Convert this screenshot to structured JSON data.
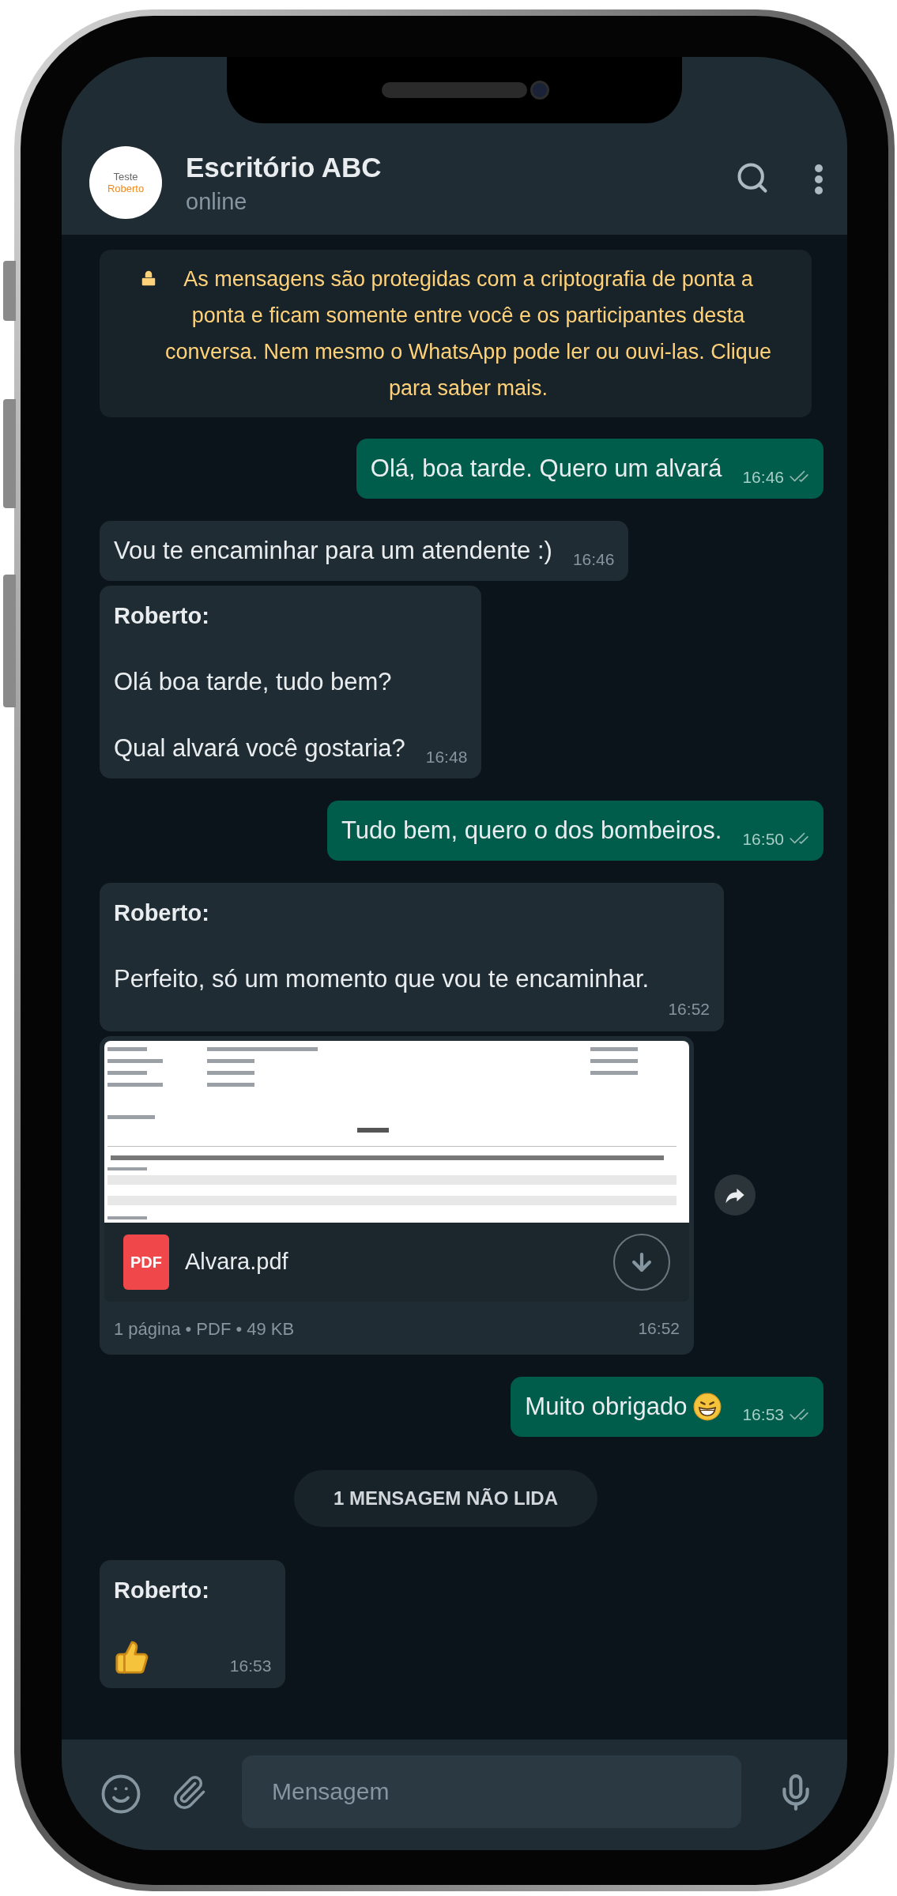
{
  "header": {
    "avatar_lines": [
      "Teste",
      "Roberto"
    ],
    "title": "Escritório ABC",
    "status": "online"
  },
  "notice": "As mensagens são protegidas com a criptografia de ponta a ponta e ficam somente entre você e os participantes desta conversa. Nem mesmo o WhatsApp pode ler ou ouvi-las. Clique para saber mais.",
  "messages": [
    {
      "kind": "text",
      "outgoing": true,
      "parts": [
        {
          "kind": "text",
          "text": "Olá, boa tarde. Quero um alvará"
        }
      ],
      "time": "16:46",
      "read": false
    },
    {
      "kind": "text",
      "outgoing": false,
      "parts": [
        {
          "kind": "text",
          "text": "Vou te encaminhar para um atendente :)"
        }
      ],
      "time": "16:46"
    },
    {
      "kind": "text",
      "outgoing": false,
      "sender": "Roberto:",
      "parts": [
        {
          "kind": "text",
          "text": "Olá boa tarde, tudo bem?"
        },
        {
          "kind": "text",
          "text": "Qual alvará você gostaria?"
        }
      ],
      "time": "16:48"
    },
    {
      "kind": "text",
      "outgoing": true,
      "parts": [
        {
          "kind": "text",
          "text": "Tudo bem, quero o dos bombeiros."
        }
      ],
      "time": "16:50",
      "read": false
    },
    {
      "kind": "text",
      "outgoing": false,
      "sender": "Roberto:",
      "parts": [
        {
          "kind": "text",
          "text": "Perfeito, só um momento que vou te encaminhar."
        }
      ],
      "time": "16:52"
    },
    {
      "kind": "document",
      "outgoing": false,
      "file_type": "PDF",
      "file_name": "Alvara.pdf",
      "meta": "1 página • PDF • 49 KB",
      "time": "16:52"
    },
    {
      "kind": "text",
      "outgoing": true,
      "parts": [
        {
          "kind": "text",
          "text": "Muito obrigado"
        },
        {
          "kind": "grin_emoji"
        }
      ],
      "time": "16:53",
      "read": false
    },
    {
      "kind": "unread",
      "text": "1 MENSAGEM NÃO LIDA"
    },
    {
      "kind": "text",
      "outgoing": false,
      "sender": "Roberto:",
      "parts": [
        {
          "kind": "thumbs_up_emoji"
        }
      ],
      "time": "16:53"
    }
  ],
  "composer": {
    "placeholder": "Mensagem"
  }
}
